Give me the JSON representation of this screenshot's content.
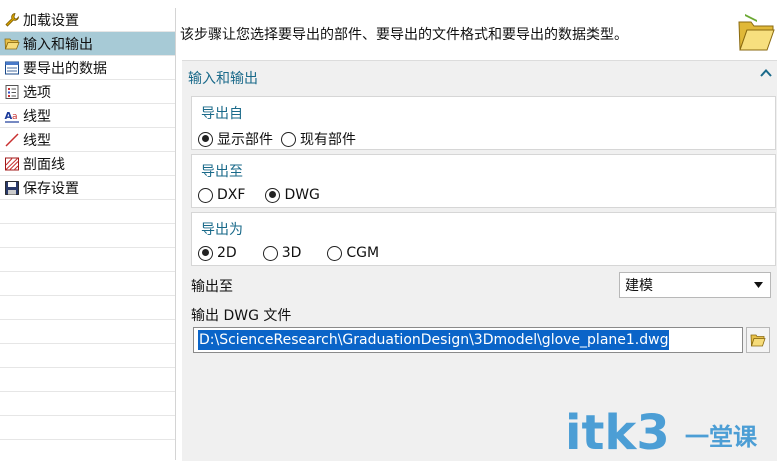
{
  "nav": {
    "items": [
      {
        "label": "加载设置",
        "icon": "wrench-icon"
      },
      {
        "label": "输入和输出",
        "icon": "folder-open-icon",
        "selected": true
      },
      {
        "label": "要导出的数据",
        "icon": "data-sheet-icon"
      },
      {
        "label": "选项",
        "icon": "options-icon"
      },
      {
        "label": "线型",
        "icon": "text-style-icon"
      },
      {
        "label": "线型",
        "icon": "line-icon"
      },
      {
        "label": "剖面线",
        "icon": "hatch-icon"
      },
      {
        "label": "保存设置",
        "icon": "save-icon"
      }
    ]
  },
  "header": {
    "description": "该步骤让您选择要导出的部件、要导出的文件格式和要导出的数据类型。"
  },
  "panel": {
    "title": "输入和输出",
    "export_from": {
      "title": "导出自",
      "options": [
        {
          "label": "显示部件",
          "selected": true
        },
        {
          "label": "现有部件",
          "selected": false
        }
      ]
    },
    "export_to": {
      "title": "导出至",
      "options": [
        {
          "label": "DXF",
          "selected": false
        },
        {
          "label": "DWG",
          "selected": true
        }
      ]
    },
    "export_as": {
      "title": "导出为",
      "options": [
        {
          "label": "2D",
          "selected": true
        },
        {
          "label": "3D",
          "selected": false
        },
        {
          "label": "CGM",
          "selected": false
        }
      ]
    },
    "output_to": {
      "label": "输出至",
      "selected": "建模"
    },
    "output_file": {
      "label": "输出 DWG 文件",
      "value": "D:\\ScienceResearch\\GraduationDesign\\3Dmodel\\glove_plane1.dwg"
    }
  },
  "watermark": {
    "text": "itk3",
    "suffix": "一堂课"
  },
  "colors": {
    "selection": "#a7cad6",
    "panel_bg": "#f0f0f0",
    "section_title": "#1a6a8a",
    "text_highlight": "#0a64c8",
    "watermark": "#2f8fd0"
  }
}
